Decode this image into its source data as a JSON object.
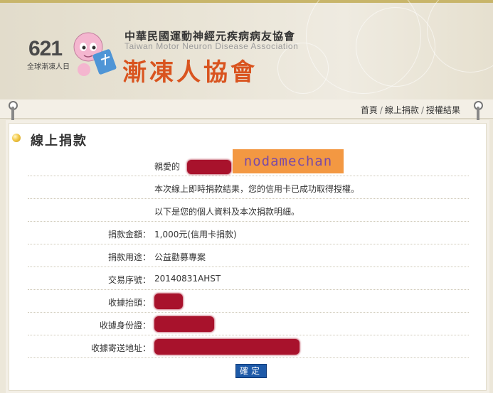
{
  "header": {
    "day_number": "621",
    "day_label": "全球漸凍人日",
    "org_name_zh": "中華民國運動神經元疾病病友協會",
    "org_name_en": "Taiwan Motor Neuron Disease Association",
    "org_short": "漸凍人協會"
  },
  "breadcrumb": {
    "items": [
      "首頁",
      "線上捐款",
      "授權結果"
    ],
    "separator": "/"
  },
  "section": {
    "title": "線上捐款"
  },
  "greeting": {
    "prefix": "親愛的",
    "suffix": ":",
    "nickname": "nodamechan"
  },
  "messages": {
    "line1": "本次線上即時捐款結果，您的信用卡已成功取得授權。",
    "line2": "以下是您的個人資料及本次捐款明細。"
  },
  "details": {
    "amount_label": "捐款金額：",
    "amount_value": "1,000元(信用卡捐款)",
    "purpose_label": "捐款用途：",
    "purpose_value": "公益勸募專案",
    "serial_label": "交易序號：",
    "serial_value": "20140831AHST",
    "receipt_title_label": "收據抬頭：",
    "receipt_id_label": "收據身份證：",
    "receipt_address_label": "收據寄送地址："
  },
  "buttons": {
    "confirm": "確定"
  },
  "colors": {
    "accent": "#d9541f",
    "redaction": "#a8122c",
    "nickname_bg": "#f39842",
    "button_bg": "#1e5aa8"
  }
}
